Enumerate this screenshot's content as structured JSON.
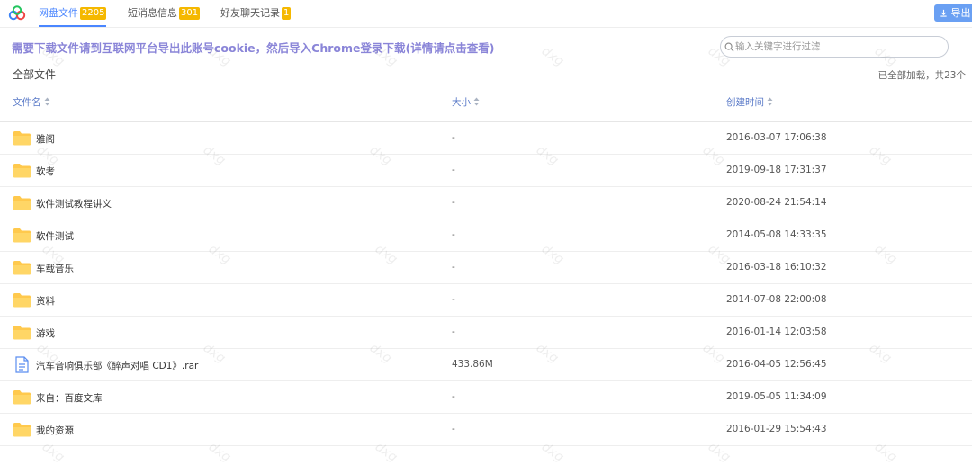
{
  "tabs": [
    {
      "label": "网盘文件",
      "badge": "2205",
      "active": true
    },
    {
      "label": "短消息信息",
      "badge": "301",
      "active": false
    },
    {
      "label": "好友聊天记录",
      "badge": "1",
      "active": false
    }
  ],
  "export_label": "导出",
  "notice": "需要下载文件请到互联网平台导出此账号cookie，然后导入Chrome登录下载(详情请点击查看)",
  "search": {
    "placeholder": "输入关键字进行过滤",
    "value": ""
  },
  "breadcrumb": "全部文件",
  "load_status": "已全部加载，共23个",
  "columns": {
    "name": "文件名",
    "size": "大小",
    "created": "创建时间"
  },
  "files": [
    {
      "name": "雅阁",
      "size": "-",
      "created": "2016-03-07 17:06:38",
      "icon": "folder-icon"
    },
    {
      "name": "软考",
      "size": "-",
      "created": "2019-09-18 17:31:37",
      "icon": "folder-icon"
    },
    {
      "name": "软件测试教程讲义",
      "size": "-",
      "created": "2020-08-24 21:54:14",
      "icon": "folder-icon"
    },
    {
      "name": "软件测试",
      "size": "-",
      "created": "2014-05-08 14:33:35",
      "icon": "folder-icon"
    },
    {
      "name": "车载音乐",
      "size": "-",
      "created": "2016-03-18 16:10:32",
      "icon": "folder-icon"
    },
    {
      "name": "资料",
      "size": "-",
      "created": "2014-07-08 22:00:08",
      "icon": "folder-icon"
    },
    {
      "name": "游戏",
      "size": "-",
      "created": "2016-01-14 12:03:58",
      "icon": "folder-icon"
    },
    {
      "name": "汽车音响俱乐部《醉声对唱 CD1》.rar",
      "size": "433.86M",
      "created": "2016-04-05 12:56:45",
      "icon": "file-icon"
    },
    {
      "name": "来自：百度文库",
      "size": "-",
      "created": "2019-05-05 11:34:09",
      "icon": "folder-icon"
    },
    {
      "name": "我的资源",
      "size": "-",
      "created": "2016-01-29 15:54:43",
      "icon": "folder-icon"
    }
  ],
  "watermark": "dxg",
  "colors": {
    "accent": "#4a86ff",
    "badge": "#f5b800",
    "folder": "#ffc94d",
    "notice": "#8a85d8"
  }
}
